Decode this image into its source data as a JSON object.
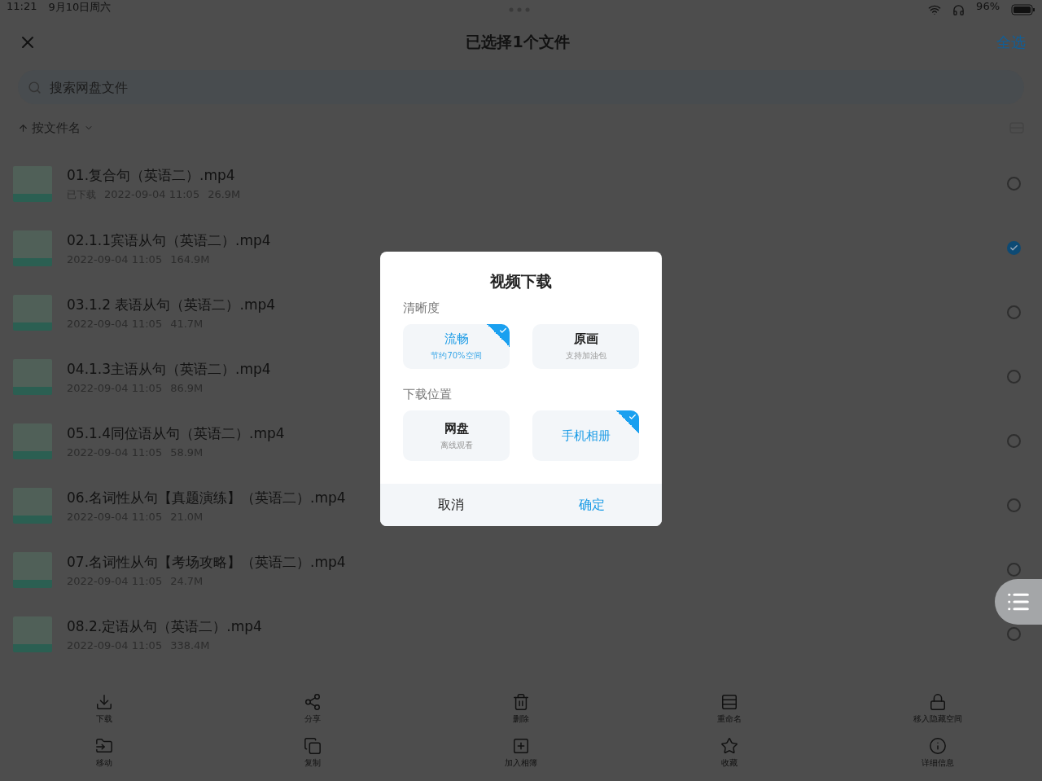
{
  "status_bar": {
    "time": "11:21",
    "date": "9月10日周六",
    "battery": "96%"
  },
  "header": {
    "title": "已选择1个文件",
    "select_all": "全选"
  },
  "search": {
    "placeholder": "搜索网盘文件"
  },
  "sort": {
    "label": "按文件名"
  },
  "files": [
    {
      "name": "01.复合句（英语二）.mp4",
      "tag": "已下载",
      "date": "2022-09-04 11:05",
      "size": "26.9M",
      "selected": false
    },
    {
      "name": "02.1.1宾语从句（英语二）.mp4",
      "date": "2022-09-04 11:05",
      "size": "164.9M",
      "selected": true
    },
    {
      "name": "03.1.2 表语从句（英语二）.mp4",
      "date": "2022-09-04 11:05",
      "size": "41.7M",
      "selected": false
    },
    {
      "name": "04.1.3主语从句（英语二）.mp4",
      "date": "2022-09-04 11:05",
      "size": "86.9M",
      "selected": false
    },
    {
      "name": "05.1.4同位语从句（英语二）.mp4",
      "date": "2022-09-04 11:05",
      "size": "58.9M",
      "selected": false
    },
    {
      "name": "06.名词性从句【真题演练】（英语二）.mp4",
      "date": "2022-09-04 11:05",
      "size": "21.0M",
      "selected": false
    },
    {
      "name": "07.名词性从句【考场攻略】（英语二）.mp4",
      "date": "2022-09-04 11:05",
      "size": "24.7M",
      "selected": false
    },
    {
      "name": "08.2.定语从句（英语二）.mp4",
      "date": "2022-09-04 11:05",
      "size": "338.4M",
      "selected": false
    }
  ],
  "toolbar": [
    {
      "kind": "download",
      "label": "下载"
    },
    {
      "kind": "share",
      "label": "分享"
    },
    {
      "kind": "delete",
      "label": "删除"
    },
    {
      "kind": "rename",
      "label": "重命名"
    },
    {
      "kind": "hide",
      "label": "移入隐藏空间"
    },
    {
      "kind": "move",
      "label": "移动"
    },
    {
      "kind": "copy",
      "label": "复制"
    },
    {
      "kind": "album",
      "label": "加入相簿"
    },
    {
      "kind": "favorite",
      "label": "收藏"
    },
    {
      "kind": "info",
      "label": "详细信息"
    }
  ],
  "dialog": {
    "title": "视频下载",
    "sections": [
      {
        "label": "清晰度",
        "options": [
          {
            "title": "流畅",
            "subtitle": "节约70%空间",
            "selected": true
          },
          {
            "title": "原画",
            "subtitle": "支持加油包",
            "selected": false
          }
        ]
      },
      {
        "label": "下载位置",
        "options": [
          {
            "title": "网盘",
            "subtitle": "离线观看",
            "selected": false
          },
          {
            "title": "手机相册",
            "selected": true
          }
        ]
      }
    ],
    "cancel": "取消",
    "confirm": "确定"
  }
}
